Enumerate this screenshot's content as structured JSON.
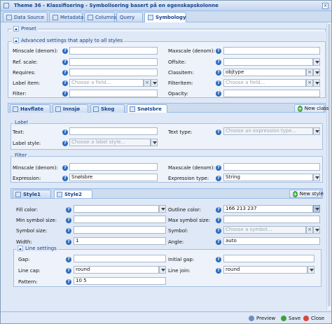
{
  "window": {
    "title": "Theme 36 - Klassifisering - Symbolisering basert på en egenskapskolonne"
  },
  "tabs": [
    "Data Source",
    "Metadata",
    "Columns",
    "Query",
    "Symbology"
  ],
  "preset": {
    "legend": "Preset"
  },
  "advanced": {
    "legend": "Advanced settings that apply to all styles",
    "minscale": "Minscale (denom):",
    "maxscale": "Maxscale (denom):",
    "refscale": "Ref. scale:",
    "offsite": "Offsite:",
    "requires": "Requires:",
    "classitem": "Classitem:",
    "classitem_value": "objtype",
    "labelitem": "Label item:",
    "labelitem_ph": "Choose a field...",
    "filteritem": "Filteritem:",
    "filteritem_ph": "Choose a field...",
    "filter": "Filter:",
    "opacity": "Opacity:"
  },
  "classes": {
    "tabs": [
      "Havflate",
      "Innsjø",
      "Skog",
      "SnøIsbre"
    ],
    "new_button": "New class"
  },
  "label": {
    "legend": "Label",
    "text": "Text:",
    "text_type": "Text type:",
    "text_type_ph": "Choose an expression type...",
    "label_style": "Label style:",
    "label_style_ph": "Choose a label style..."
  },
  "filter_section": {
    "legend": "Filter",
    "minscale": "Minscale (denom):",
    "maxscale": "Maxscale (denom):",
    "expression": "Expression:",
    "expression_value": "SnøIsbre",
    "expression_type": "Expression type:",
    "expression_type_value": "String"
  },
  "styles": {
    "tabs": [
      "Style1",
      "Style2"
    ],
    "new_button": "New style",
    "fill_color": "Fill color:",
    "outline_color": "Outline color:",
    "outline_value": "166 213 237",
    "min_symbol": "Min symbol size:",
    "max_symbol": "Max symbol size:",
    "symbol_size": "Symbol size:",
    "symbol": "Symbol:",
    "symbol_ph": "Choose a symbol...",
    "width": "Width:",
    "width_value": "1",
    "angle": "Angle:",
    "angle_value": "auto"
  },
  "line": {
    "legend": "Line settings",
    "gap": "Gap:",
    "initial_gap": "Initial gap:",
    "line_cap": "Line cap:",
    "line_cap_value": "round",
    "line_join": "Line join:",
    "line_join_value": "round",
    "pattern": "Pattern:",
    "pattern_value": "10 5"
  },
  "footer": {
    "preview": "Preview",
    "save": "Save",
    "close": "Close"
  },
  "colors": {
    "accent": "#15428b",
    "add": "#3aa23a",
    "help": "#2d6cc0"
  }
}
